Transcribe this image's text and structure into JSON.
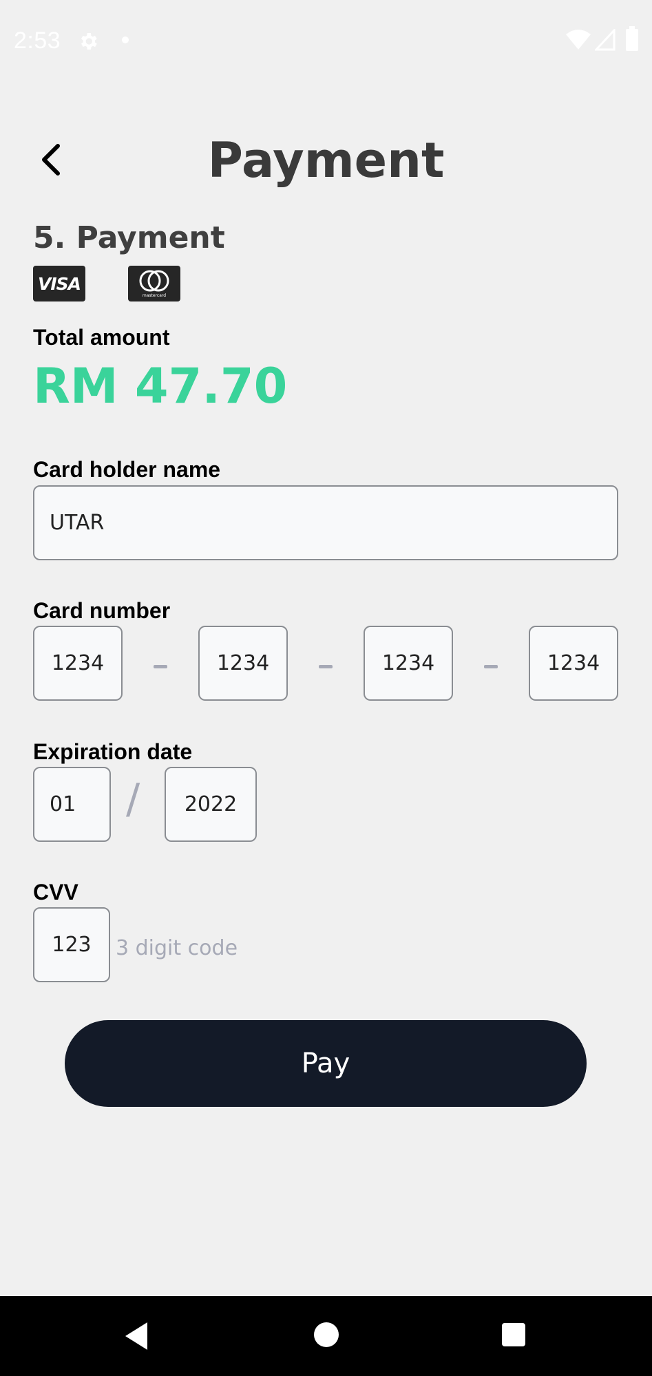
{
  "status_bar": {
    "time": "2:53",
    "icons": [
      "gear-icon",
      "dot-icon",
      "wifi-icon",
      "signal-icon",
      "battery-icon"
    ]
  },
  "header": {
    "title": "Payment",
    "back_icon": "chevron-left-icon"
  },
  "section": {
    "title": "5. Payment",
    "card_logos": [
      "VISA",
      "mastercard"
    ]
  },
  "total": {
    "label": "Total amount",
    "value": "RM 47.70",
    "color": "#3ad39a"
  },
  "card_holder": {
    "label": "Card holder name",
    "value": "UTAR"
  },
  "card_number": {
    "label": "Card number",
    "groups": [
      "1234",
      "1234",
      "1234",
      "1234"
    ]
  },
  "expiration": {
    "label": "Expiration date",
    "month": "01",
    "separator": "/",
    "year": "2022"
  },
  "cvv": {
    "label": "CVV",
    "value": "123",
    "hint": "3 digit code"
  },
  "pay_button": {
    "label": "Pay",
    "color": "#131a28"
  },
  "nav_bar": {
    "icons": [
      "back-triangle-icon",
      "home-circle-icon",
      "recents-square-icon"
    ]
  }
}
